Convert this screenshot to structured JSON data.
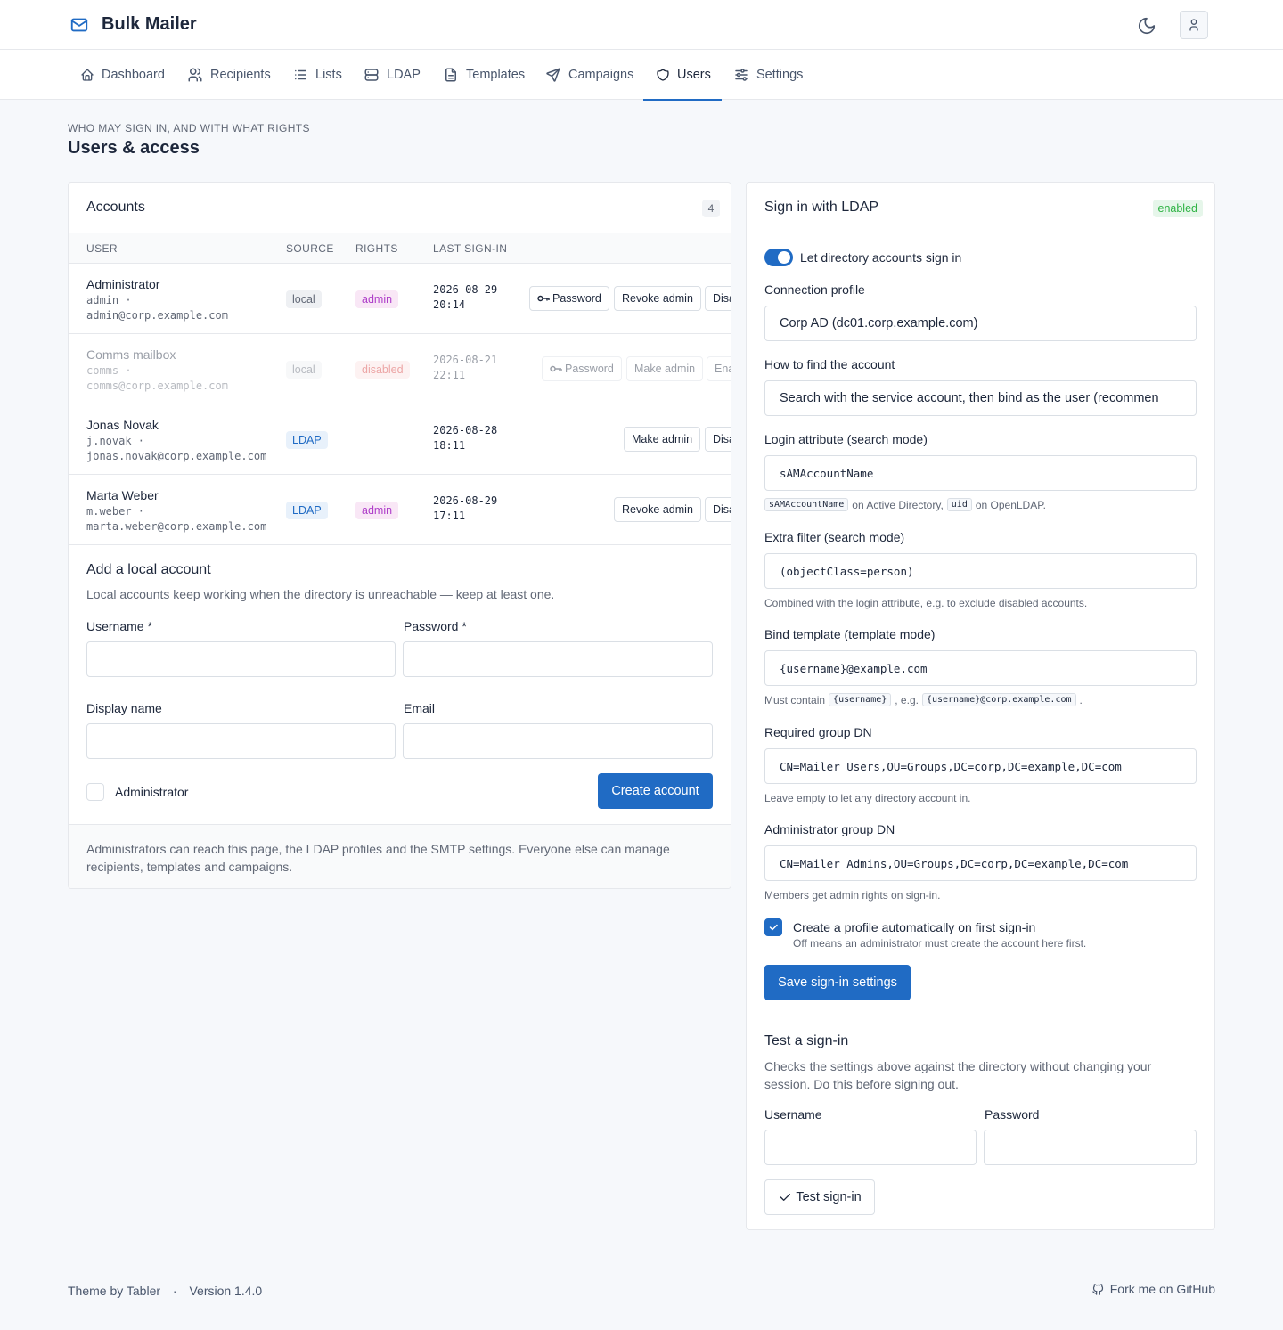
{
  "app": {
    "name": "Bulk Mailer",
    "logo_icon": "mail-icon"
  },
  "nav": [
    {
      "label": "Dashboard",
      "icon": "home-icon"
    },
    {
      "label": "Recipients",
      "icon": "users-icon"
    },
    {
      "label": "Lists",
      "icon": "list-icon"
    },
    {
      "label": "LDAP",
      "icon": "server-icon"
    },
    {
      "label": "Templates",
      "icon": "file-icon"
    },
    {
      "label": "Campaigns",
      "icon": "send-icon"
    },
    {
      "label": "Users",
      "icon": "shield-icon",
      "active": true
    },
    {
      "label": "Settings",
      "icon": "sliders-icon"
    }
  ],
  "page": {
    "pretitle": "Who may sign in, and with what rights",
    "title": "Users & access"
  },
  "accounts": {
    "title": "Accounts",
    "count": "4",
    "columns": {
      "user": "User",
      "source": "Source",
      "rights": "Rights",
      "last_signin": "Last sign-in"
    },
    "rows": [
      {
        "name": "Administrator",
        "login": "admin ·",
        "email": "admin@corp.example.com",
        "source": "local",
        "rights": "admin",
        "date": "2026-08-29",
        "time": "20:14",
        "btn1": "Password",
        "btn2": "Revoke admin",
        "btn3": "Disable"
      },
      {
        "name": "Comms mailbox",
        "login": "comms ·",
        "email": "comms@corp.example.com",
        "source": "local",
        "rights": "disabled",
        "date": "2026-08-21",
        "time": "22:11",
        "btn1": "Password",
        "btn2": "Make admin",
        "btn3": "Enable"
      },
      {
        "name": "Jonas Novak",
        "login": "j.novak ·",
        "email": "jonas.novak@corp.example.com",
        "source": "LDAP",
        "rights": "",
        "date": "2026-08-28",
        "time": "18:11",
        "btn2": "Make admin",
        "btn3": "Disable"
      },
      {
        "name": "Marta Weber",
        "login": "m.weber ·",
        "email": "marta.weber@corp.example.com",
        "source": "LDAP",
        "rights": "admin",
        "date": "2026-08-29",
        "time": "17:11",
        "btn2": "Revoke admin",
        "btn3": "Disable"
      }
    ]
  },
  "add_local": {
    "title": "Add a local account",
    "subtitle": "Local accounts keep working when the directory is unreachable — keep at least one.",
    "username_label": "Username *",
    "password_label": "Password *",
    "display_label": "Display name",
    "email_label": "Email",
    "admin_label": "Administrator",
    "submit": "Create account"
  },
  "accounts_footer": "Administrators can reach this page, the LDAP profiles and the SMTP settings. Everyone else can manage recipients, templates and campaigns.",
  "ldap": {
    "title": "Sign in with LDAP",
    "status": "enabled",
    "toggle_label": "Let directory accounts sign in",
    "profile_label": "Connection profile",
    "profile_value": "Corp AD (dc01.corp.example.com)",
    "find_label": "How to find the account",
    "find_value": "Search with the service account, then bind as the user (recommended)",
    "login_attr_label": "Login attribute (search mode)",
    "login_attr_value": "sAMAccountName",
    "login_attr_hint": {
      "code1": "sAMAccountName",
      "text1": "on Active Directory,",
      "code2": "uid",
      "text2": "on OpenLDAP."
    },
    "filter_label": "Extra filter (search mode)",
    "filter_value": "(objectClass=person)",
    "filter_hint": "Combined with the login attribute, e.g. to exclude disabled accounts.",
    "bind_label": "Bind template (template mode)",
    "bind_value": "{username}@example.com",
    "bind_hint": {
      "text1": "Must contain",
      "code1": "{username}",
      "text2": ", e.g.",
      "code2": "{username}@corp.example.com",
      "text3": "."
    },
    "group_label": "Required group DN",
    "group_value": "CN=Mailer Users,OU=Groups,DC=corp,DC=example,DC=com",
    "group_hint": "Leave empty to let any directory account in.",
    "admin_group_label": "Administrator group DN",
    "admin_group_value": "CN=Mailer Admins,OU=Groups,DC=corp,DC=example,DC=com",
    "admin_group_hint": "Members get admin rights on sign-in.",
    "auto_label": "Create a profile automatically on first sign-in",
    "auto_hint": "Off means an administrator must create the account here first.",
    "save": "Save sign-in settings"
  },
  "test": {
    "title": "Test a sign-in",
    "subtitle": "Checks the settings above against the directory without changing your session. Do this before signing out.",
    "username_label": "Username",
    "password_label": "Password",
    "button": "Test sign-in"
  },
  "footer": {
    "theme": "Theme by Tabler",
    "sep": "·",
    "version": "Version 1.4.0",
    "github": "Fork me on GitHub"
  }
}
